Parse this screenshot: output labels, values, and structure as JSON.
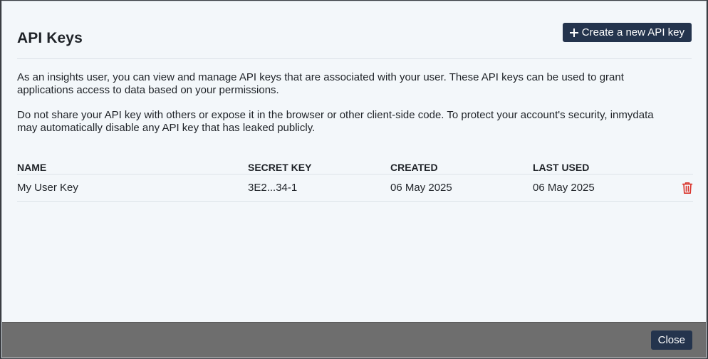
{
  "header": {
    "title": "API Keys",
    "create_label": "Create a new API key"
  },
  "description": {
    "paragraph_1": "As an insights user, you can view and manage API keys that are associated with your user. These API keys can be used to grant applications access to data based on your permissions.",
    "paragraph_2": "Do not share your API key with others or expose it in the browser or other client-side code. To protect your account's security, inmydata may automatically disable any API key that has leaked publicly."
  },
  "table": {
    "columns": {
      "name": "NAME",
      "secret": "SECRET KEY",
      "created": "CREATED",
      "last_used": "LAST USED"
    },
    "rows": [
      {
        "name": "My User Key",
        "secret": "3E2...34-1",
        "created": "06 May 2025",
        "last_used": "06 May 2025",
        "delete_icon": "trash-icon"
      }
    ]
  },
  "footer": {
    "close_label": "Close"
  },
  "colors": {
    "primary_button": "#24344d",
    "danger": "#d9342b",
    "modal_background": "#f3f7fa",
    "footer_background": "#6e6e6e"
  }
}
